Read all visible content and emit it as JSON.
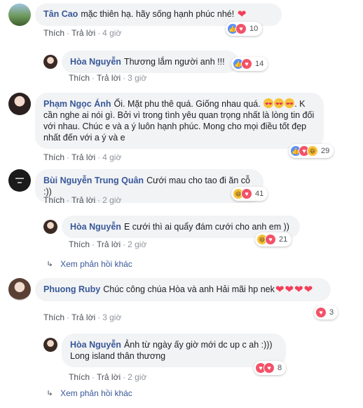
{
  "actions": {
    "like": "Thích",
    "reply": "Trả lời",
    "dot": "·"
  },
  "comments": [
    {
      "name": "Tân Cao",
      "text": "mặc thiên hạ. hãy sống hạnh phúc nhé!",
      "emoji": [
        "heart"
      ],
      "time": "4 giờ",
      "reactions": [
        "like",
        "love"
      ],
      "count": "10",
      "replies": [
        {
          "name": "Hòa Nguyễn",
          "text": "Thương lắm người anh !!!",
          "time": "3 giờ",
          "reactions": [
            "like",
            "love"
          ],
          "count": "14"
        }
      ]
    },
    {
      "name": "Phạm Ngọc Ánh",
      "text_1": "Ối. Mặt phu thê quá. Giống nhau quá.",
      "emoji": [
        "heart-eyes",
        "heart-eyes",
        "heart-eyes"
      ],
      "text_2": ". K cần nghe ai nói gì. Bởi vì trong tình yêu quan trọng nhất là lòng tin đối với nhau. Chúc e và a ý luôn hạnh phúc. Mong cho mọi điều tốt đẹp nhất đến với a ý và e",
      "time": "4 giờ",
      "reactions": [
        "like",
        "love",
        "haha"
      ],
      "count": "29"
    },
    {
      "name": "Bùi Nguyễn Trung Quân",
      "text": "Cưới mau cho tao đi ăn cỗ :))",
      "time": "2 giờ",
      "reactions": [
        "haha",
        "love"
      ],
      "count": "41",
      "replies": [
        {
          "name": "Hòa Nguyễn",
          "text": "E cưới thì ai quẩy đám cưới cho anh em ))",
          "time": "2 giờ",
          "reactions": [
            "haha",
            "love"
          ],
          "count": "21"
        }
      ],
      "more_replies": "Xem phản hồi khác"
    },
    {
      "name": "Phuong Ruby",
      "text": "Chúc công chúa Hòa và anh Hải mãi hp nek",
      "emoji": [
        "heart",
        "heart",
        "heart",
        "heart"
      ],
      "time": "3 giờ",
      "reactions": [
        "love"
      ],
      "count": "3",
      "replies": [
        {
          "name": "Hòa Nguyễn",
          "text": "Ảnh từ ngày ấy giờ mới dc up c ah :))) Long island thân thương",
          "time": "2 giờ",
          "reactions": [
            "love",
            "love"
          ],
          "count": "8"
        }
      ],
      "more_replies": "Xem phản hồi khác"
    }
  ],
  "colors": {
    "name": "#385898",
    "bubble": "#f2f3f5",
    "like": "#5890ff",
    "love": "#f25268",
    "haha": "#f7c23a"
  }
}
